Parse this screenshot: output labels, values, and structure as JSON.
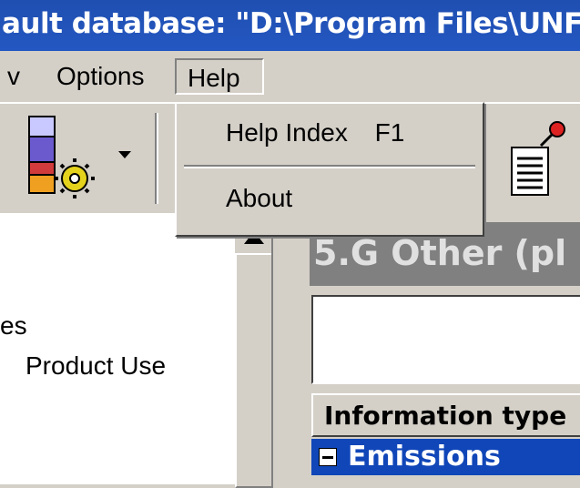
{
  "window": {
    "title": "ault database: \"D:\\Program Files\\UNF"
  },
  "menubar": {
    "items": [
      "Options",
      "Help"
    ],
    "partial_item": "v"
  },
  "help_menu": {
    "items": [
      {
        "label": "Help Index",
        "shortcut": "F1"
      },
      {
        "label": "About"
      }
    ]
  },
  "toolbar": {
    "icons": [
      "database-settings-icon",
      "dropdown-arrow-icon",
      "notepad-pin-icon"
    ]
  },
  "tree": {
    "items": [
      "es",
      "Product Use"
    ]
  },
  "panel": {
    "heading": "5.G Other (pl",
    "table_header": "Information type",
    "row_label": "Emissions"
  },
  "colors": {
    "titlebar": "#2457c2",
    "selected_row": "#1046b8",
    "chrome": "#d4d0c8"
  }
}
